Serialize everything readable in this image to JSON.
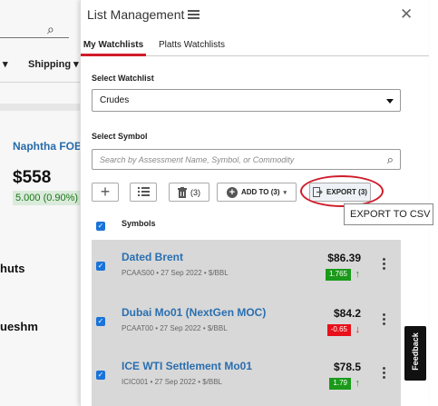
{
  "background": {
    "nav_caret": "▾",
    "nav_shipping": "Shipping ▾",
    "card_title": "Naphtha FOB I",
    "card_price": "$558",
    "card_change": "5.000 (0.90%)",
    "partial_word_1": "huts",
    "partial_word_2": "ueshm"
  },
  "panel": {
    "title": "List Management",
    "tabs": [
      "My Watchlists",
      "Platts Watchlists"
    ],
    "active_tab": 0,
    "select_watchlist_label": "Select Watchlist",
    "watchlist_value": "Crudes",
    "select_symbol_label": "Select Symbol",
    "search_placeholder": "Search by Assessment Name, Symbol, or Commodity",
    "toolbar": {
      "delete_count": "(3)",
      "add_to_label": "ADD TO (3)",
      "export_label": "EXPORT (3)"
    },
    "tooltip": "EXPORT TO CSV",
    "symbols_header": "Symbols",
    "rows": [
      {
        "name": "Dated Brent",
        "sub": "PCAAS00 • 27 Sep 2022 • $/BBL",
        "price": "$86.39",
        "change": "1.765",
        "direction": "up"
      },
      {
        "name": "Dubai Mo01 (NextGen MOC)",
        "sub": "PCAAT00 • 27 Sep 2022 • $/BBL",
        "price": "$84.2",
        "change": "-0.65",
        "direction": "down"
      },
      {
        "name": "ICE WTI Settlement Mo01",
        "sub": "ICIC001 • 27 Sep 2022 • $/BBL",
        "price": "$78.5",
        "change": "1.79",
        "direction": "up"
      }
    ]
  },
  "feedback_label": "Feedback",
  "colors": {
    "accent": "#d01c2a",
    "link": "#2a6fb0",
    "up": "#1a9a1a",
    "down": "#e8101a",
    "checkbox": "#1a73d9"
  }
}
